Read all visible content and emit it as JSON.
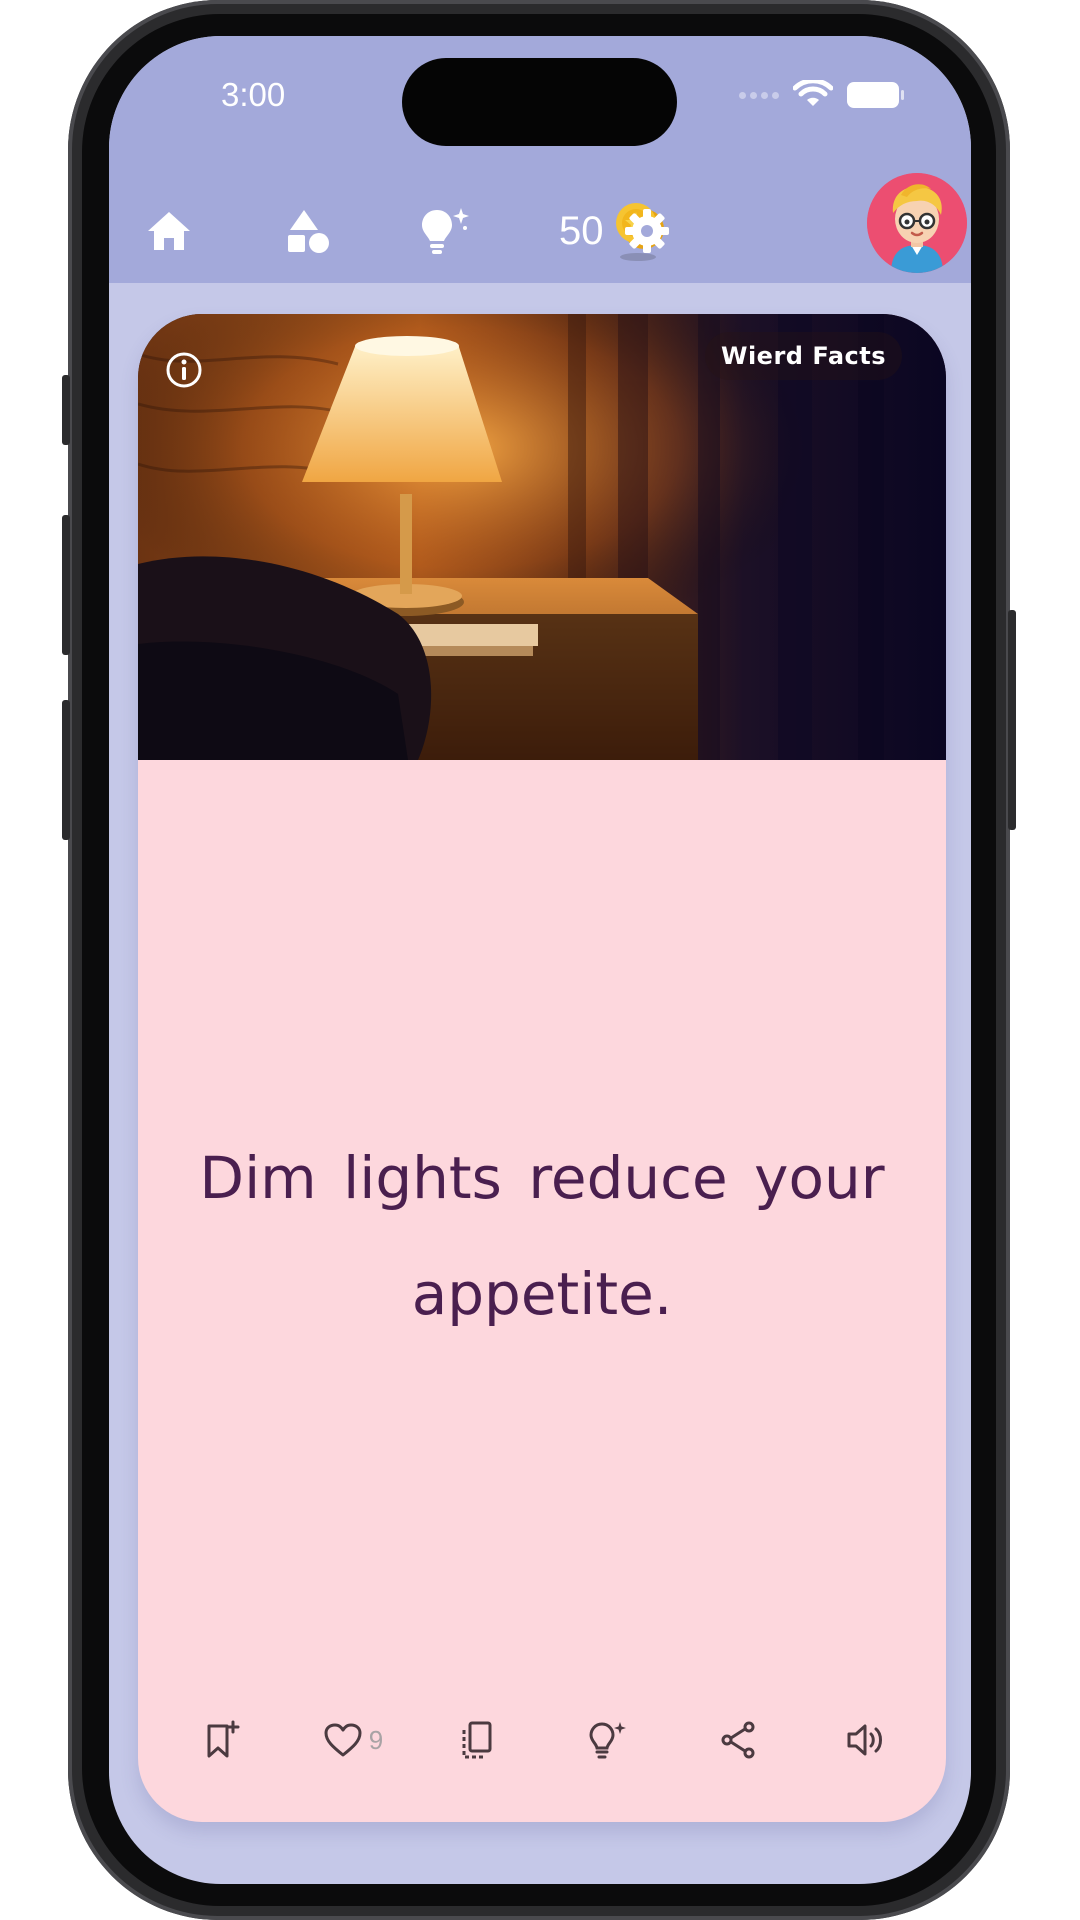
{
  "status_bar": {
    "time": "3:00"
  },
  "nav": {
    "home_icon": "home-icon",
    "categories_icon": "shapes-icon",
    "ideas_icon": "lightbulb-sparkle-icon",
    "coins": "50",
    "coin_icon": "coin-stack-icon",
    "settings_icon": "gear-icon",
    "avatar_icon": "avatar-boy-glasses"
  },
  "card": {
    "category": "Wierd Facts",
    "fact": "Dim lights reduce your appetite.",
    "image": "bedside-lamp-photo",
    "likes": "9",
    "colors": {
      "card_bg": "#fdd7dd",
      "text": "#4a1f4f",
      "header_bg": "#a3a9da",
      "screen_bg": "#c5c8e8"
    }
  },
  "actions": {
    "bookmark_icon": "bookmark-add-icon",
    "like_icon": "heart-icon",
    "copy_icon": "copy-icon",
    "idea_icon": "lightbulb-sparkle-icon",
    "share_icon": "share-icon",
    "sound_icon": "speaker-icon"
  }
}
